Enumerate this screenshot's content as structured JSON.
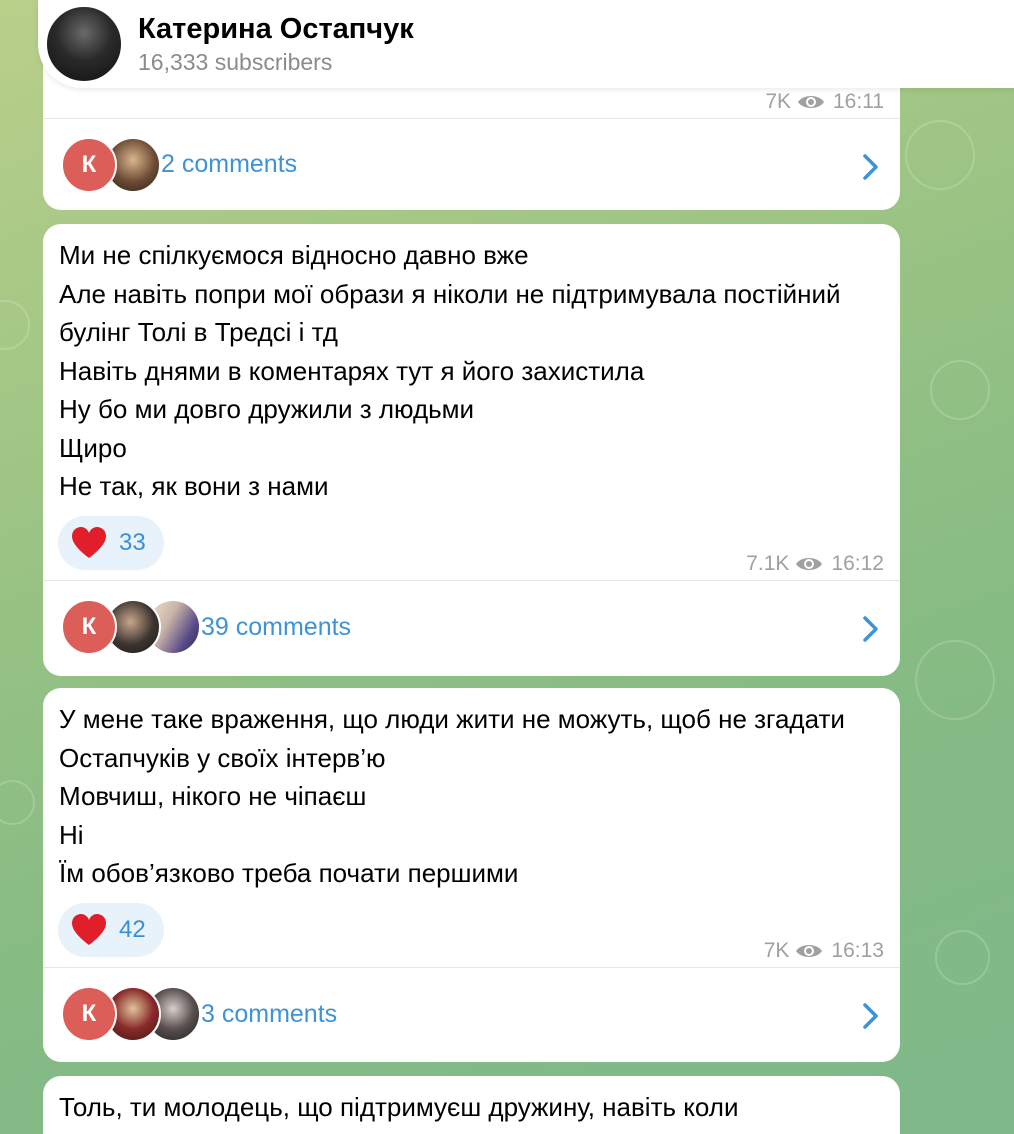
{
  "header": {
    "channel_name": "Катерина Остапчук",
    "subscribers": "16,333 subscribers"
  },
  "posts": [
    {
      "views": "7K",
      "time": "16:11",
      "comments_label": "2 comments",
      "avatar_letter": "К"
    },
    {
      "text": "Ми не спілкуємося відносно давно вже\nАле навіть попри мої образи я ніколи не підтримувала постійний булінг Толі в Тредсі і тд\nНавіть днями в коментарях тут я його захистила\nНу бо ми довго дружили з людьми\nЩиро\nНе так, як вони з нами",
      "reaction_emoji": "heart-icon",
      "reaction_count": "33",
      "views": "7.1K",
      "time": "16:12",
      "comments_label": "39 comments",
      "avatar_letter": "К"
    },
    {
      "text": "У мене таке враження, що люди жити не можуть, щоб не згадати Остапчуків у своїх інтерв’ю\nМовчиш, нікого не чіпаєш\nНі\nЇм обов’язково треба почати першими",
      "reaction_emoji": "heart-icon",
      "reaction_count": "42",
      "views": "7K",
      "time": "16:13",
      "comments_label": "3 comments",
      "avatar_letter": "К"
    },
    {
      "text": "Толь, ти молодець, що підтримуєш дружину, навіть коли"
    }
  ],
  "colors": {
    "accent": "#3e93d6",
    "reaction_bg": "#e8f2fb",
    "heart": "#e01f2b",
    "avatar_k": "#db5e58",
    "meta": "#a0a0a0"
  }
}
